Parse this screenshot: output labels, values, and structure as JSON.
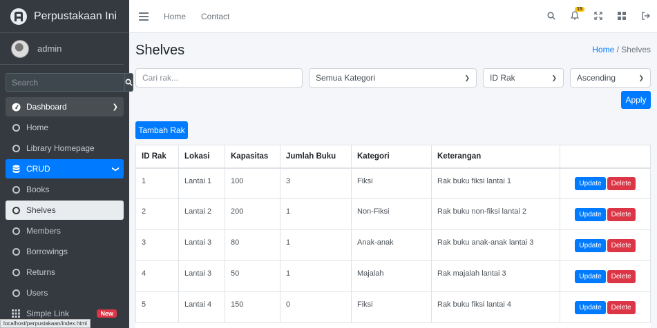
{
  "sidebar": {
    "brand": "Perpustakaan Ini",
    "user": "admin",
    "search_placeholder": "Search",
    "items": [
      {
        "label": "Dashboard"
      },
      {
        "label": "Home"
      },
      {
        "label": "Library Homepage"
      },
      {
        "label": "CRUD"
      },
      {
        "label": "Books"
      },
      {
        "label": "Shelves"
      },
      {
        "label": "Members"
      },
      {
        "label": "Borrowings"
      },
      {
        "label": "Returns"
      },
      {
        "label": "Users"
      },
      {
        "label": "Simple Link",
        "badge": "New"
      }
    ]
  },
  "statusbar": "localhost/perpustakaan/index.html",
  "navbar": {
    "links": [
      "Home",
      "Contact"
    ],
    "notification_count": "15"
  },
  "page": {
    "title": "Shelves",
    "breadcrumb_home": "Home",
    "breadcrumb_current": "Shelves"
  },
  "filters": {
    "search_placeholder": "Cari rak...",
    "category": "Semua Kategori",
    "sort_by": "ID Rak",
    "order": "Ascending",
    "apply_label": "Apply"
  },
  "add_button": "Tambah Rak",
  "table": {
    "headers": [
      "ID Rak",
      "Lokasi",
      "Kapasitas",
      "Jumlah Buku",
      "Kategori",
      "Keterangan",
      ""
    ],
    "rows": [
      [
        "1",
        "Lantai 1",
        "100",
        "3",
        "Fiksi",
        "Rak buku fiksi lantai 1"
      ],
      [
        "2",
        "Lantai 2",
        "200",
        "1",
        "Non-Fiksi",
        "Rak buku non-fiksi lantai 2"
      ],
      [
        "3",
        "Lantai 3",
        "80",
        "1",
        "Anak-anak",
        "Rak buku anak-anak lantai 3"
      ],
      [
        "4",
        "Lantai 3",
        "50",
        "1",
        "Majalah",
        "Rak majalah lantai 3"
      ],
      [
        "5",
        "Lantai 4",
        "150",
        "0",
        "Fiksi",
        "Rak buku fiksi lantai 4"
      ]
    ],
    "update_label": "Update",
    "delete_label": "Delete"
  },
  "colors": {
    "primary": "#007bff",
    "danger": "#dc3545",
    "sidebar_bg": "#343a40",
    "warning": "#ffc107"
  }
}
